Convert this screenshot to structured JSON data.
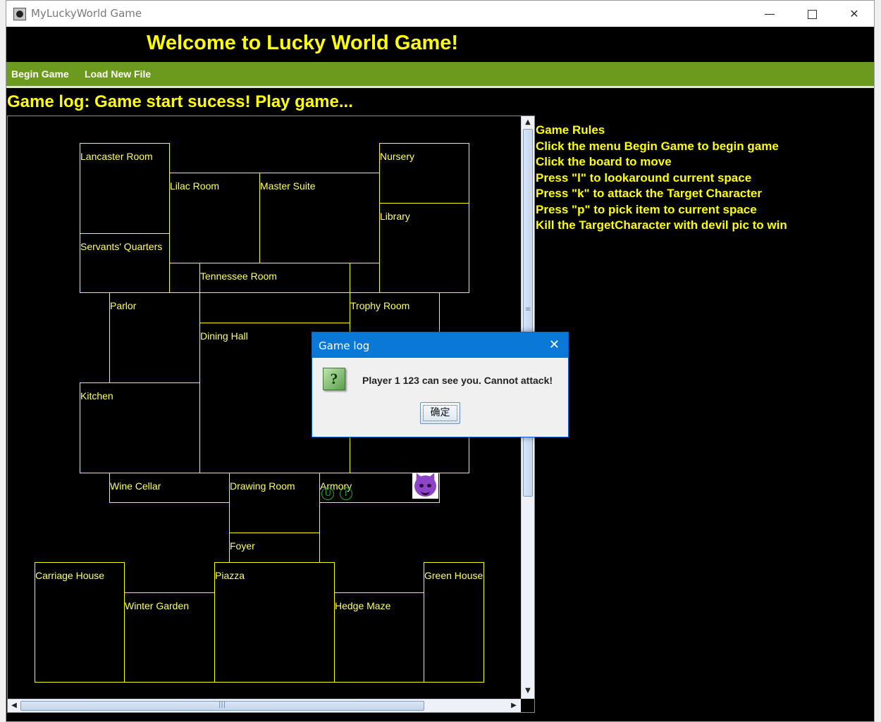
{
  "window": {
    "title": "MyLuckyWorld Game",
    "minimize": "—",
    "close": "✕"
  },
  "header": {
    "welcome": "Welcome to Lucky World Game!"
  },
  "menu": {
    "begin_game": "Begin Game",
    "load_new_file": "Load New File"
  },
  "game_log": "Game log: Game start sucess! Play game...",
  "board": {
    "rooms": [
      {
        "name": "Lancaster Room"
      },
      {
        "name": "Nursery"
      },
      {
        "name": "Lilac Room"
      },
      {
        "name": "Master Suite"
      },
      {
        "name": "Library"
      },
      {
        "name": "Servants' Quarters"
      },
      {
        "name": "Tennessee Room"
      },
      {
        "name": "Parlor"
      },
      {
        "name": "Trophy Room"
      },
      {
        "name": "Dining Hall"
      },
      {
        "name": "Kitchen"
      },
      {
        "name": "Wine Cellar"
      },
      {
        "name": "Drawing Room"
      },
      {
        "name": "Armory"
      },
      {
        "name": "Foyer"
      },
      {
        "name": "Carriage House"
      },
      {
        "name": "Piazza"
      },
      {
        "name": "Green House"
      },
      {
        "name": "Winter Garden"
      },
      {
        "name": "Hedge Maze"
      }
    ],
    "player_tokens": [
      "U",
      "I"
    ],
    "target_icon": "devil-face-icon"
  },
  "rules": {
    "lines": [
      "Game Rules",
      "Click the menu Begin Game to begin game",
      "Click the board to move",
      "Press \"l\" to lookaround current space",
      "Press \"k\" to attack the Target Character",
      "Press \"p\" to pick item to current space",
      "Kill the TargetCharacter with devil pic to win"
    ]
  },
  "dialog": {
    "title": "Game log",
    "message": "Player 1 123 can see you. Cannot attack!",
    "ok_label": "确定",
    "icon": "question-icon"
  },
  "colors": {
    "accent": "#ffff00",
    "menubar": "#6b9a1e",
    "dialog_title": "#0a78d7"
  }
}
